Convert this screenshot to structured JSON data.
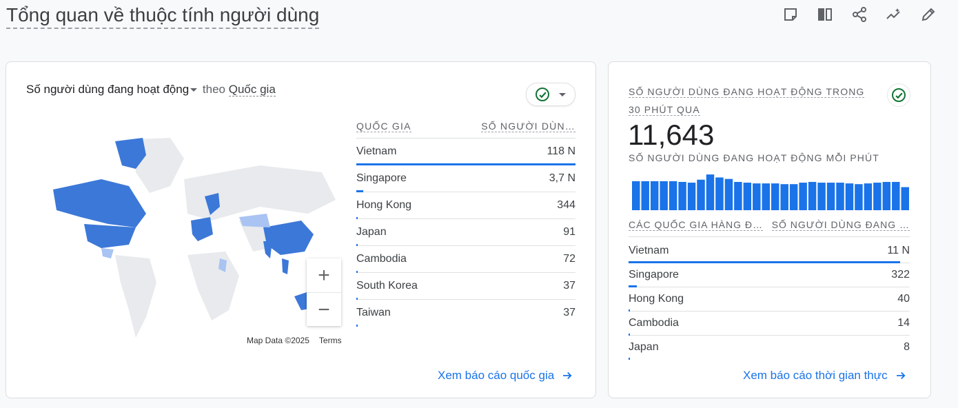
{
  "page": {
    "title": "Tổng quan về thuộc tính người dùng",
    "toolbar_icons": [
      "note-icon",
      "compare-icon",
      "share-icon",
      "insights-icon",
      "edit-icon"
    ]
  },
  "country_card": {
    "metric": "Số người dùng đang hoạt động",
    "by": "theo",
    "dimension": "Quốc gia",
    "map_footer": {
      "data": "Map Data ©2025",
      "terms": "Terms"
    },
    "zoom": {
      "in": "+",
      "out": "−"
    },
    "table": {
      "col_country": "QUỐC GIA",
      "col_users": "SỐ NGƯỜI DÙN…",
      "rows": [
        {
          "country": "Vietnam",
          "value": "118 N",
          "share": 1.0
        },
        {
          "country": "Singapore",
          "value": "3,7 N",
          "share": 0.031
        },
        {
          "country": "Hong Kong",
          "value": "344",
          "share": 0.003
        },
        {
          "country": "Japan",
          "value": "91",
          "share": 0.001
        },
        {
          "country": "Cambodia",
          "value": "72",
          "share": 0.001
        },
        {
          "country": "South Korea",
          "value": "37",
          "share": 0.0003
        },
        {
          "country": "Taiwan",
          "value": "37",
          "share": 0.0003
        }
      ]
    },
    "link": "Xem báo cáo quốc gia"
  },
  "realtime_card": {
    "label": "SỐ NGƯỜI DÙNG ĐANG HOẠT ĐỘNG TRONG 30 PHÚT QUA",
    "total": "11,643",
    "per_minute_label": "SỐ NGƯỜI DÙNG ĐANG HOẠT ĐỘNG MỖI PHÚT",
    "per_minute_bars": [
      0.78,
      0.78,
      0.78,
      0.78,
      0.78,
      0.76,
      0.74,
      0.82,
      0.96,
      0.88,
      0.84,
      0.76,
      0.74,
      0.72,
      0.72,
      0.72,
      0.7,
      0.7,
      0.74,
      0.76,
      0.74,
      0.74,
      0.74,
      0.72,
      0.7,
      0.72,
      0.74,
      0.76,
      0.76,
      0.62
    ],
    "col_country": "CÁC QUỐC GIA HÀNG Đ…",
    "col_users": "SỐ NGƯỜI DÙNG ĐANG …",
    "rows": [
      {
        "country": "Vietnam",
        "value": "11 N",
        "share": 0.965
      },
      {
        "country": "Singapore",
        "value": "322",
        "share": 0.03
      },
      {
        "country": "Hong Kong",
        "value": "40",
        "share": 0.004
      },
      {
        "country": "Cambodia",
        "value": "14",
        "share": 0.002
      },
      {
        "country": "Japan",
        "value": "8",
        "share": 0.001
      }
    ],
    "link": "Xem báo cáo thời gian thực"
  },
  "colors": {
    "accent": "#1a73e8",
    "ok": "#137333",
    "map_active": "#3c78d8",
    "map_light": "#a9c3f2",
    "map_base": "#e8eaed"
  }
}
